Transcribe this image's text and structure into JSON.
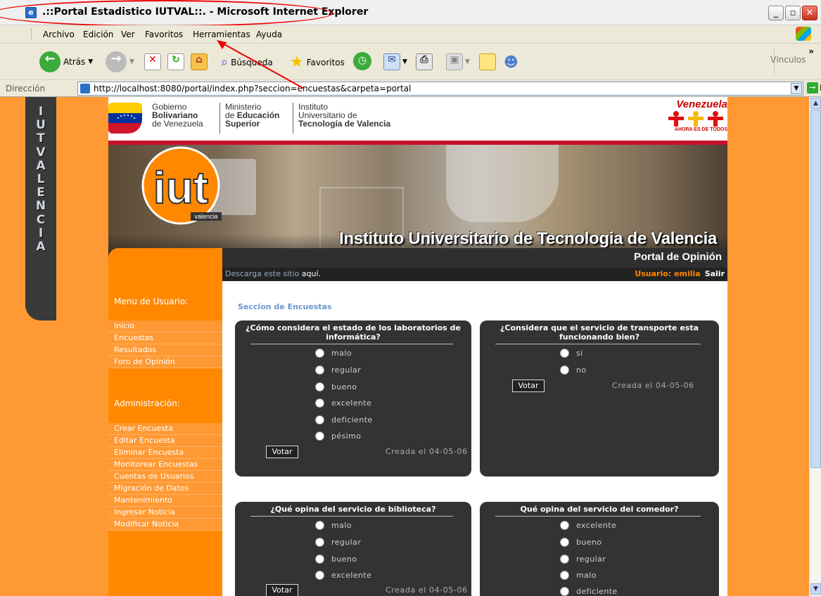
{
  "window": {
    "title": ".::Portal Estadistico IUTVAL::. - Microsoft Internet Explorer",
    "controls": {
      "minimize": "_",
      "maximize": "▫",
      "close": "✕"
    }
  },
  "menubar": {
    "items": [
      "Archivo",
      "Edición",
      "Ver",
      "Favoritos",
      "Herramientas",
      "Ayuda"
    ]
  },
  "toolbar": {
    "back_label": "Atrás",
    "search_label": "Búsqueda",
    "favorites_label": "Favoritos",
    "links_label": "Vínculos",
    "overflow": "»"
  },
  "addressbar": {
    "label": "Dirección",
    "url": "http://localhost:8080/portal/index.php?seccion=encuestas&carpeta=portal",
    "go_label": "Ir"
  },
  "sideband": {
    "text": "IUTVALENCIA"
  },
  "header": {
    "gov_line1": "Gobierno",
    "gov_line2": "Bolivariano",
    "gov_line3": "de Venezuela",
    "min_line1": "Ministerio",
    "min_line2_a": "de ",
    "min_line2_b": "Educación",
    "min_line3": "Superior",
    "inst_line1": "Instituto",
    "inst_line2": "Universitario de",
    "inst_line3": "Tecnología de Valencia",
    "venezuela": "Venezuela",
    "venezuela_slogan": "AHORA ES DE TODOS"
  },
  "banner": {
    "title": "Instituto Universitario de Tecnologia de Valencia",
    "logo_text": "iut",
    "logo_sub": "valencia"
  },
  "portal_title": "Portal de Opinión",
  "infobar": {
    "download_text": "Descarga este sitio",
    "download_link": "aquí.",
    "user": "Usuario: emilia",
    "logout": "Salir"
  },
  "leftmenu": {
    "user_heading": "Menu de Usuario:",
    "user_items": [
      "Inicio",
      "Encuestas",
      "Resultados",
      "Foro de Opinión"
    ],
    "admin_heading": "Administración:",
    "admin_items": [
      "Crear Encuesta",
      "Editar Encuesta",
      "Eliminar Encuesta",
      "Monitorear Encuestas",
      "Cuentas de Usuarios",
      "Migración de Datos",
      "Mantenimiento",
      "Ingresar Noticia",
      "Modificar Noticia"
    ]
  },
  "content": {
    "section_title": "Seccion de Encuestas",
    "vote_label": "Votar",
    "polls": [
      {
        "question": "¿Cómo considera el estado de los laboratorios de informática?",
        "options": [
          "malo",
          "regular",
          "bueno",
          "excelente",
          "deficiente",
          "pésimo"
        ],
        "created": "Creada el 04-05-06"
      },
      {
        "question": "¿Considera que el servicio de transporte esta funcionando bien?",
        "options": [
          "si",
          "no"
        ],
        "created": "Creada el 04-05-06"
      },
      {
        "question": "¿Qué opina del servicio de biblioteca?",
        "options": [
          "malo",
          "regular",
          "bueno",
          "excelente"
        ],
        "created": "Creada el 04-05-06"
      },
      {
        "question": "Qué opina del servicio del comedor?",
        "options": [
          "excelente",
          "bueno",
          "regular",
          "malo",
          "deficiente"
        ],
        "created": ""
      }
    ]
  },
  "colors": {
    "page_orange": "#ff9933",
    "menu_orange": "#ff8800",
    "poll_box": "#333333",
    "annotation_red": "#e00000"
  }
}
